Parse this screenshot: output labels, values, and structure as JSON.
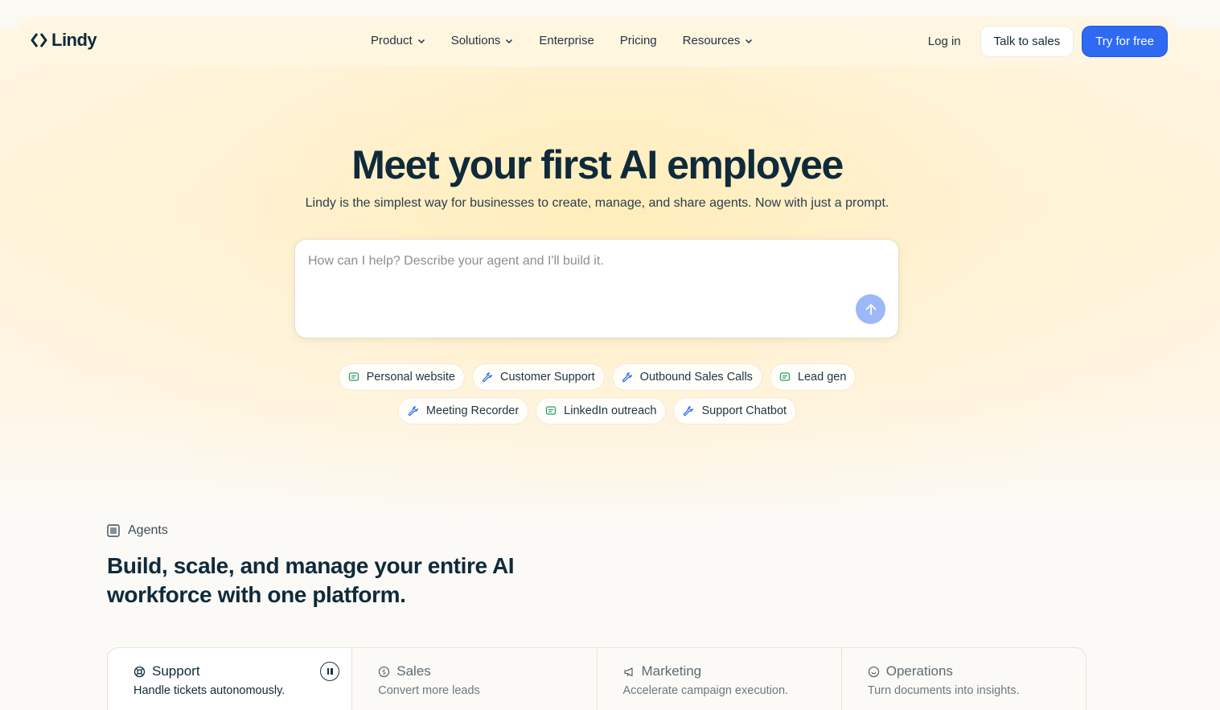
{
  "brand": {
    "name": "Lindy",
    "accent": "#2f6bf2"
  },
  "nav": {
    "links": [
      {
        "label": "Product",
        "dropdown": true
      },
      {
        "label": "Solutions",
        "dropdown": true
      },
      {
        "label": "Enterprise",
        "dropdown": false
      },
      {
        "label": "Pricing",
        "dropdown": false
      },
      {
        "label": "Resources",
        "dropdown": true
      }
    ],
    "login": "Log in",
    "talk_to_sales": "Talk to sales",
    "try_free": "Try for free"
  },
  "hero": {
    "title": "Meet your first AI employee",
    "subtitle": "Lindy is the simplest way for businesses to create, manage, and share agents. Now with just a prompt.",
    "prompt_placeholder": "How can I help? Describe your agent and I'll build it.",
    "prompt_value": "",
    "chips_row1": [
      {
        "label": "Personal website",
        "icon": "message-icon"
      },
      {
        "label": "Customer Support",
        "icon": "wrench-icon"
      },
      {
        "label": "Outbound Sales Calls",
        "icon": "wrench-icon"
      },
      {
        "label": "Lead gen",
        "icon": "message-icon"
      }
    ],
    "chips_row2": [
      {
        "label": "Meeting Recorder",
        "icon": "wrench-icon"
      },
      {
        "label": "LinkedIn outreach",
        "icon": "message-icon"
      },
      {
        "label": "Support Chatbot",
        "icon": "wrench-icon"
      }
    ]
  },
  "agents": {
    "tag": "Agents",
    "title": "Build, scale, and manage your entire AI workforce with one platform.",
    "tabs": [
      {
        "label": "Support",
        "desc": "Handle tickets autonomously.",
        "icon": "lifebuoy-icon",
        "active": true
      },
      {
        "label": "Sales",
        "desc": "Convert more leads",
        "icon": "dollar-icon",
        "active": false
      },
      {
        "label": "Marketing",
        "desc": "Accelerate campaign execution.",
        "icon": "megaphone-icon",
        "active": false
      },
      {
        "label": "Operations",
        "desc": "Turn documents into insights.",
        "icon": "smile-icon",
        "active": false
      }
    ]
  }
}
